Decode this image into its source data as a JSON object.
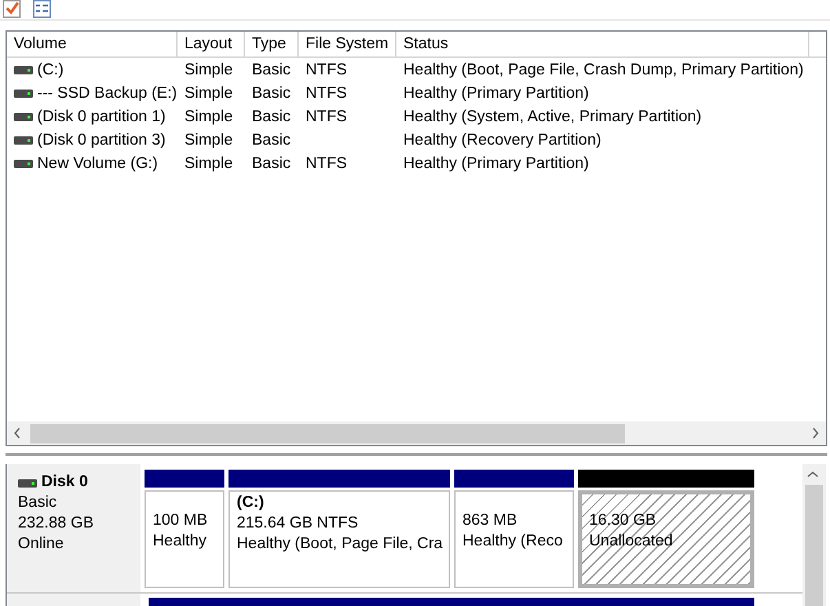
{
  "table": {
    "columns": [
      "Volume",
      "Layout",
      "Type",
      "File System",
      "Status"
    ],
    "rows": [
      {
        "volume": "(C:)",
        "layout": "Simple",
        "type": "Basic",
        "file_system": "NTFS",
        "status": "Healthy (Boot, Page File, Crash Dump, Primary Partition)"
      },
      {
        "volume": "--- SSD Backup (E:)",
        "layout": "Simple",
        "type": "Basic",
        "file_system": "NTFS",
        "status": "Healthy (Primary Partition)"
      },
      {
        "volume": "(Disk 0 partition 1)",
        "layout": "Simple",
        "type": "Basic",
        "file_system": "NTFS",
        "status": "Healthy (System, Active, Primary Partition)"
      },
      {
        "volume": "(Disk 0 partition 3)",
        "layout": "Simple",
        "type": "Basic",
        "file_system": "",
        "status": "Healthy (Recovery Partition)"
      },
      {
        "volume": "New Volume (G:)",
        "layout": "Simple",
        "type": "Basic",
        "file_system": "NTFS",
        "status": "Healthy (Primary Partition)"
      }
    ]
  },
  "disks": [
    {
      "name": "Disk 0",
      "type": "Basic",
      "size": "232.88 GB",
      "status": "Online",
      "partitions": [
        {
          "kind": "primary",
          "size": "100 MB",
          "status": "Healthy"
        },
        {
          "kind": "primary",
          "label": "(C:)",
          "size": "215.64 GB NTFS",
          "status": "Healthy (Boot, Page File, Cra"
        },
        {
          "kind": "primary",
          "size": "863 MB",
          "status": "Healthy (Reco"
        },
        {
          "kind": "unallocated",
          "size": "16.30 GB",
          "status": "Unallocated"
        }
      ]
    }
  ]
}
